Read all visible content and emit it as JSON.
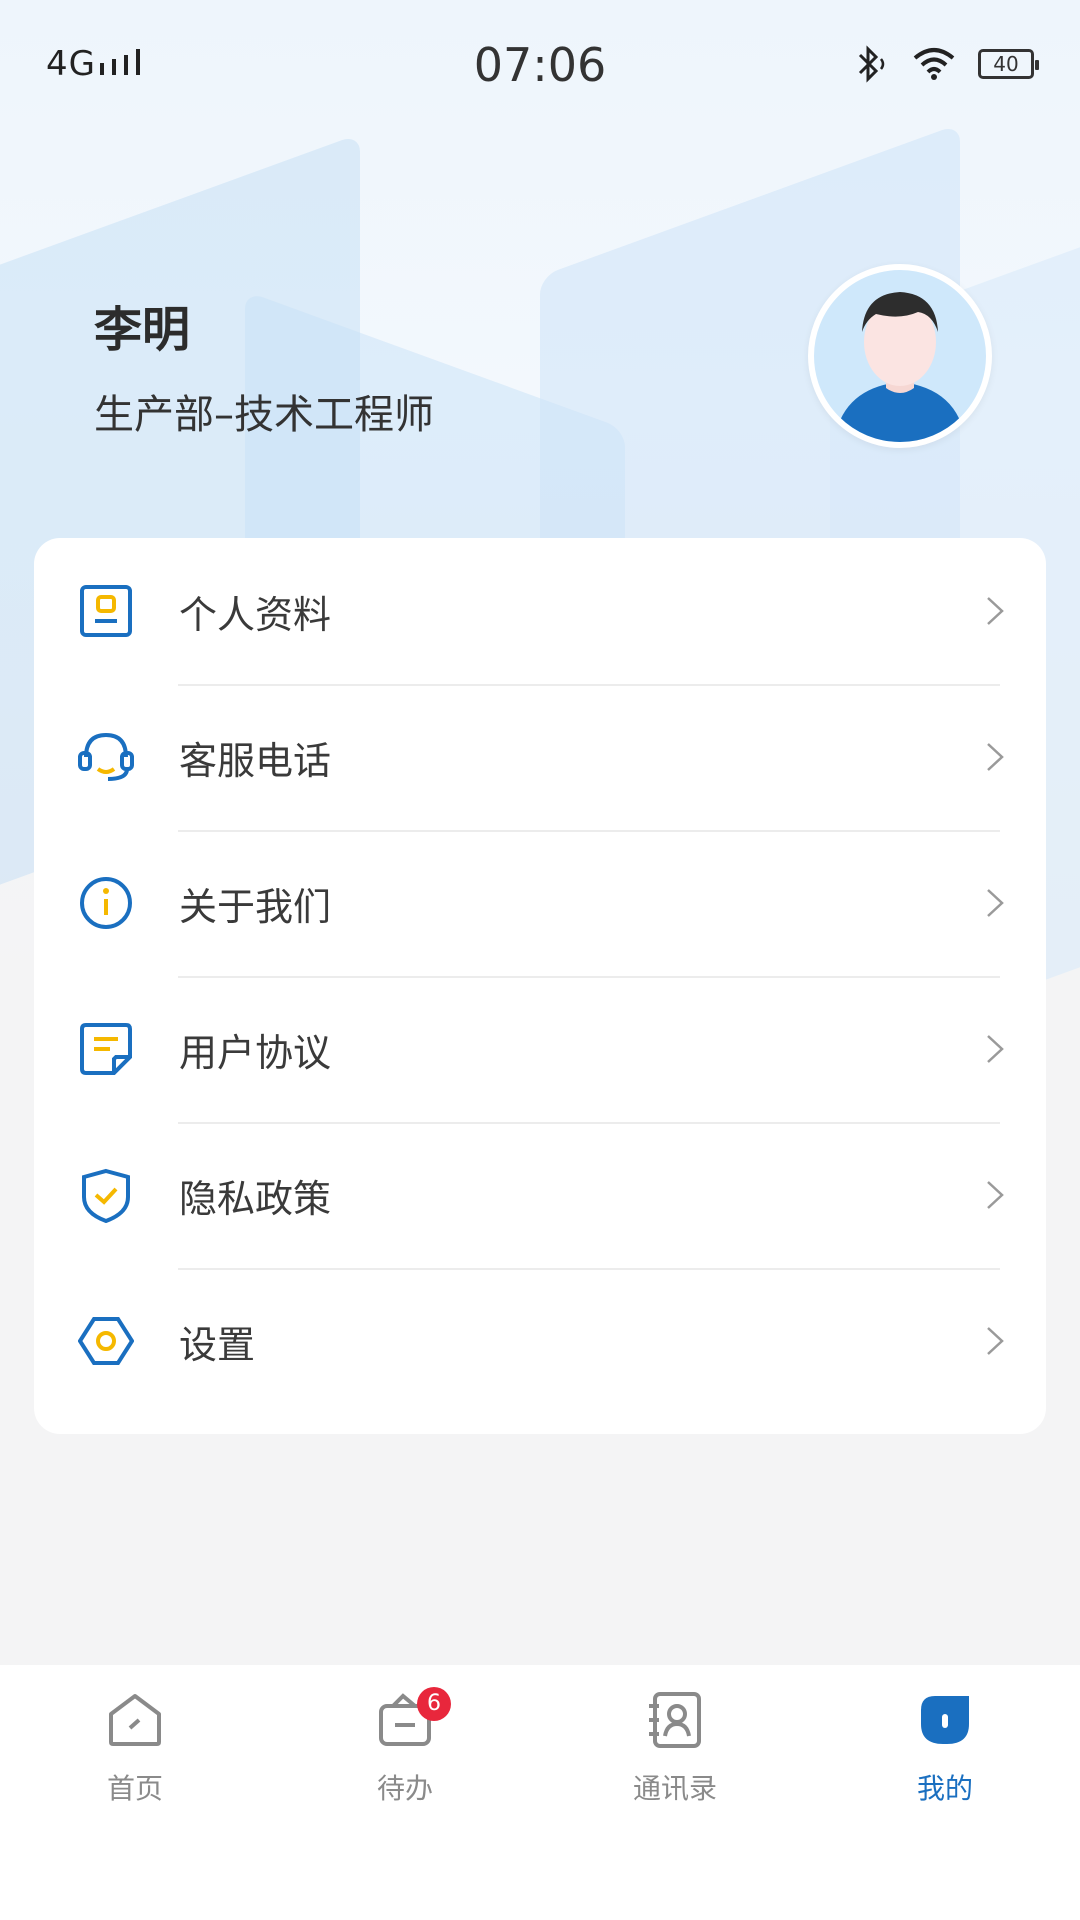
{
  "status_bar": {
    "network": "4G",
    "time": "07:06",
    "battery": "40"
  },
  "profile": {
    "name": "李明",
    "department": "生产部–技术工程师"
  },
  "menu": {
    "items": [
      {
        "label": "个人资料",
        "icon": "profile-card-icon"
      },
      {
        "label": "客服电话",
        "icon": "headset-icon"
      },
      {
        "label": "关于我们",
        "icon": "info-icon"
      },
      {
        "label": "用户协议",
        "icon": "agreement-icon"
      },
      {
        "label": "隐私政策",
        "icon": "shield-icon"
      },
      {
        "label": "设置",
        "icon": "settings-icon"
      }
    ]
  },
  "tab_bar": {
    "tabs": [
      {
        "label": "首页",
        "icon": "home-icon",
        "active": false
      },
      {
        "label": "待办",
        "icon": "todo-icon",
        "active": false,
        "badge": "6"
      },
      {
        "label": "通讯录",
        "icon": "contacts-icon",
        "active": false
      },
      {
        "label": "我的",
        "icon": "mine-icon",
        "active": true
      }
    ]
  },
  "colors": {
    "primary_blue": "#1a6fc0",
    "accent_yellow": "#f5b800",
    "badge_red": "#e8273c"
  }
}
